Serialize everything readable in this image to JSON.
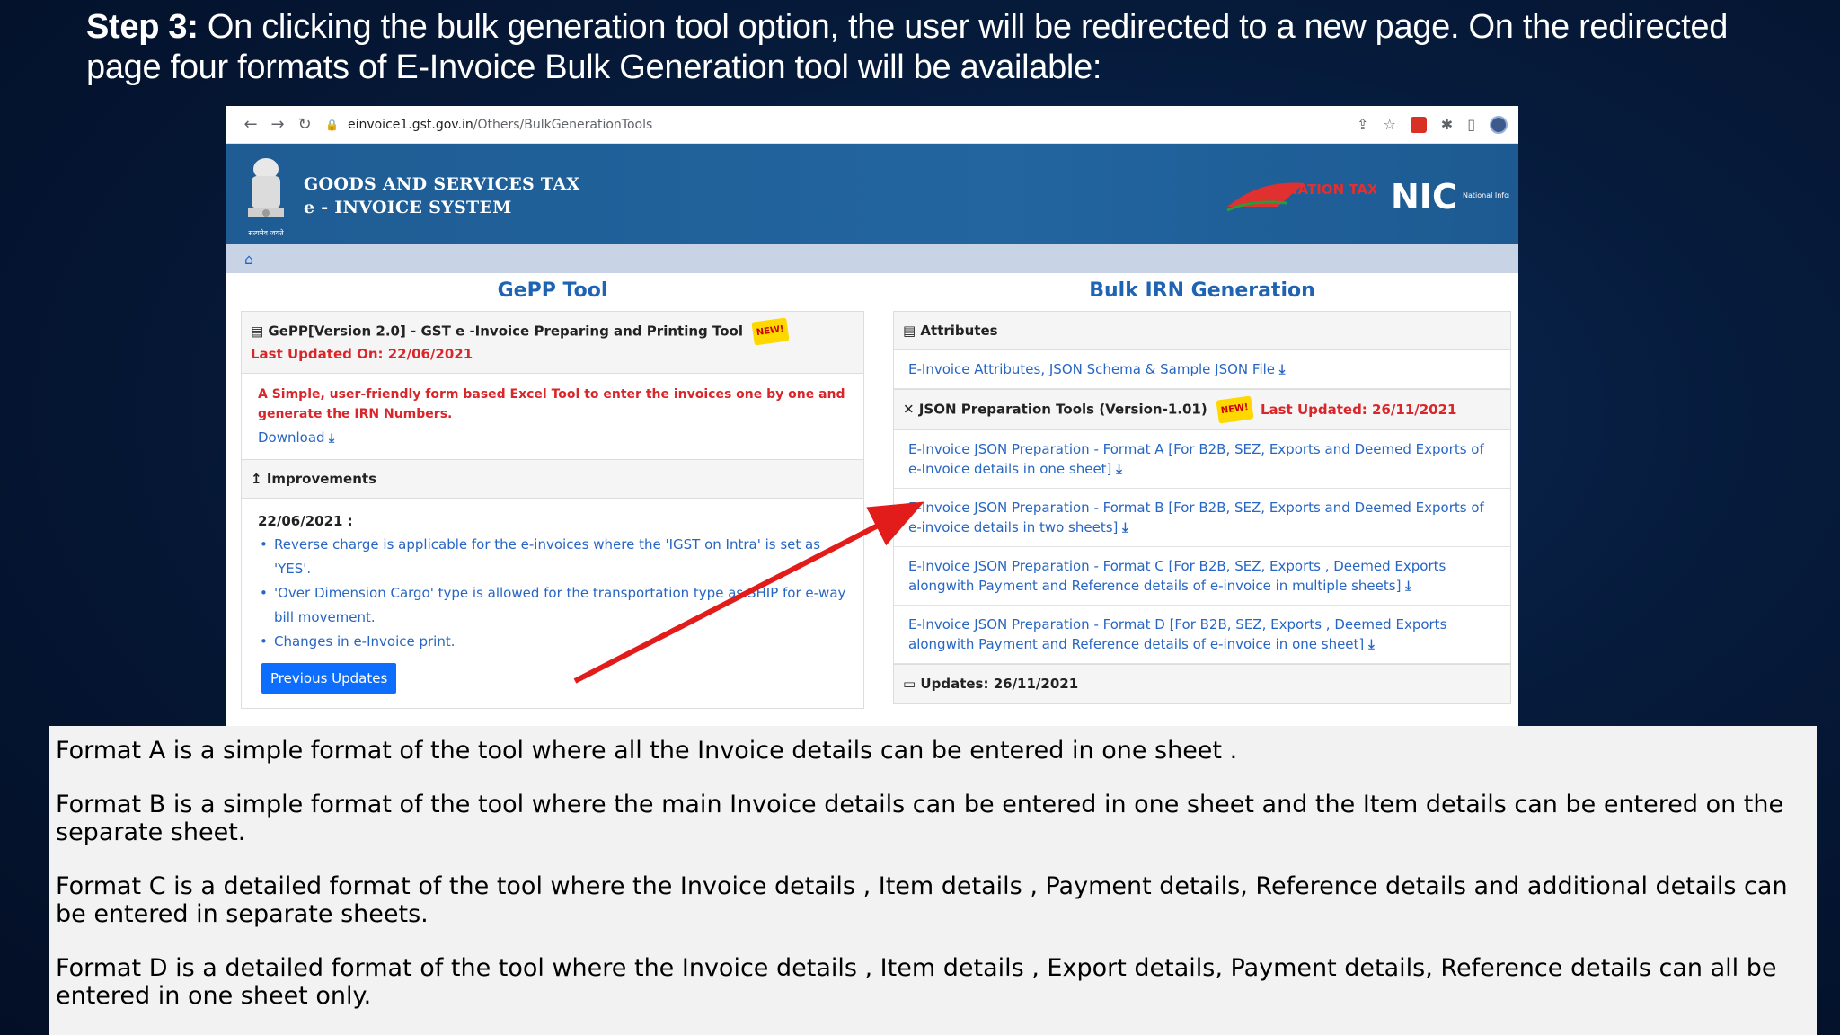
{
  "slide": {
    "step_label": "Step 3:",
    "step_text": " On clicking the bulk generation tool option, the user will be redirected to a new page. On the redirected page four formats of E-Invoice Bulk Generation tool will be available:"
  },
  "browser": {
    "url_host": "einvoice1.gst.gov.in",
    "url_path": "/Others/BulkGenerationTools"
  },
  "site": {
    "title_line1": "GOODS AND SERVICES TAX",
    "title_line2": "e - INVOICE SYSTEM",
    "emblem_caption": "सत्यमेव जयते",
    "logo_tm_text": "NATION TAX MARKET",
    "logo_nic_text": "NIC",
    "logo_nic_sub": "National Informatics Centre"
  },
  "left": {
    "title": "GePP Tool",
    "gepp_heading": "GePP[Version 2.0] - GST e -Invoice Preparing and Printing Tool",
    "new_badge": "NEW!",
    "last_updated": "Last Updated On: 22/06/2021",
    "description": "A Simple, user-friendly form based Excel Tool to enter the invoices one by one and generate the IRN Numbers.",
    "download_label": "Download",
    "improvements_heading": "Improvements",
    "improvements_date": "22/06/2021 :",
    "improvements": [
      "Reverse charge is applicable for the e-invoices where the 'IGST on Intra' is set as 'YES'.",
      "'Over Dimension Cargo' type is allowed for the transportation type as SHIP for e-way bill movement.",
      "Changes in e-Invoice print."
    ],
    "prev_button": "Previous Updates"
  },
  "right": {
    "title": "Bulk IRN Generation",
    "attributes_heading": "Attributes",
    "attributes_link": "E-Invoice Attributes, JSON Schema & Sample JSON File",
    "json_tools_heading": "JSON Preparation Tools (Version-1.01)",
    "new_badge": "NEW!",
    "json_last_updated": "Last Updated: 26/11/2021",
    "formats": [
      "E-Invoice JSON Preparation - Format A [For B2B, SEZ, Exports and Deemed Exports of e-Invoice details in one sheet]",
      "E-Invoice JSON Preparation - Format B [For B2B, SEZ, Exports and Deemed Exports of e-invoice details in two sheets]",
      "E-Invoice JSON Preparation - Format C [For B2B, SEZ, Exports , Deemed Exports alongwith Payment and Reference details of e-invoice in multiple sheets]",
      "E-Invoice JSON Preparation - Format D [For B2B, SEZ, Exports , Deemed Exports alongwith Payment and Reference details of e-invoice in one sheet]"
    ],
    "updates_heading": "Updates: 26/11/2021"
  },
  "notes": [
    "Format A is a simple format of the tool where all the Invoice details can be entered in one sheet .",
    "Format B  is a simple format of the tool where the main Invoice details can be entered in one sheet  and the Item details can be entered on the separate sheet.",
    "Format C is a detailed format of the tool where the Invoice details , Item details , Payment details, Reference details and additional details can be entered in separate sheets.",
    "Format D is a detailed format of the tool where the Invoice details , Item details , Export details, Payment details, Reference details can all be entered in one sheet only."
  ],
  "colors": {
    "arrow": "#e21b1b",
    "header_blue": "#1f5c94",
    "link_blue": "#2766c4",
    "alert_red": "#d9262a"
  }
}
